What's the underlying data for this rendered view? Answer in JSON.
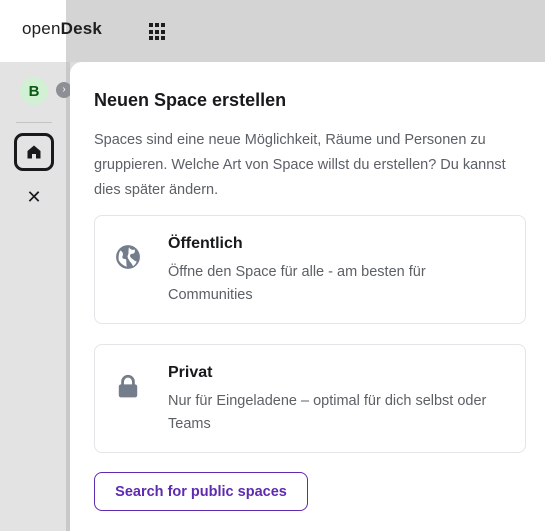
{
  "app": {
    "logo_part1": "open",
    "logo_part2": "Desk"
  },
  "icons": {
    "apps_menu": "apps-grid-icon",
    "home": "home-icon",
    "close": "close-icon",
    "public_space": "globe-icon",
    "private_space": "lock-icon",
    "collapse": "chevron-right-icon"
  },
  "sidebar": {
    "avatar_letter": "B",
    "close_glyph": "✕",
    "collapse_glyph": "›"
  },
  "dialog": {
    "title": "Neuen Space erstellen",
    "description": "Spaces sind eine neue Möglichkeit, Räume und Personen zu gruppieren. Welche Art von Space willst du erstellen? Du kannst dies später ändern.",
    "options": [
      {
        "title": "Öffentlich",
        "description": "Öffne den Space für alle - am besten für Communities"
      },
      {
        "title": "Privat",
        "description": "Nur für Eingeladene – optimal für dich selbst oder Teams"
      }
    ],
    "search_button": "Search for public spaces"
  },
  "colors": {
    "accent": "#5e2bb0",
    "avatar_bg": "#d1f0d4",
    "avatar_text": "#0a5a16",
    "icon_gray": "#737d8c"
  }
}
